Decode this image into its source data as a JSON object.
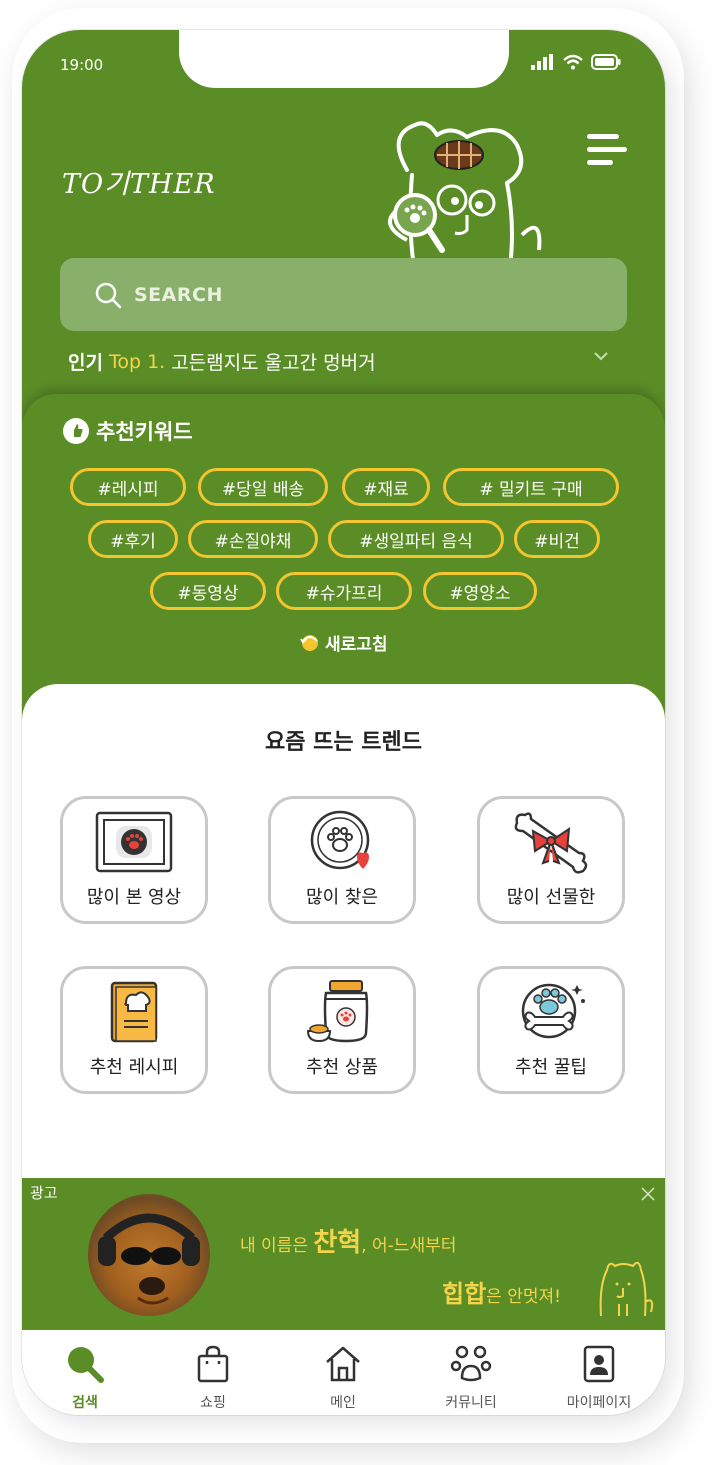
{
  "status": {
    "time": "19:00"
  },
  "header": {
    "logo": "TO기THER",
    "menu_icon": "hamburger-icon"
  },
  "search": {
    "placeholder": "SEARCH"
  },
  "popular": {
    "prefix": "인기",
    "rank": "Top 1.",
    "text": "고든램지도 울고간 멍버거"
  },
  "keywords": {
    "title": "추천키워드",
    "tags": [
      "#레시피",
      "#당일 배송",
      "#재료",
      "# 밀키트 구매",
      "#후기",
      "#손질야채",
      "#생일파티 음식",
      "#비건",
      "#동영상",
      "#슈가프리",
      "#영양소"
    ],
    "refresh": "새로고침"
  },
  "trends": {
    "title": "요즘 뜨는 트렌드",
    "items": [
      {
        "label": "많이 본 영상",
        "icon": "video-paw-icon"
      },
      {
        "label": "많이 찾은",
        "icon": "paw-heart-icon"
      },
      {
        "label": "많이 선물한",
        "icon": "bone-ribbon-icon"
      },
      {
        "label": "추천 레시피",
        "icon": "recipe-book-icon"
      },
      {
        "label": "추천 상품",
        "icon": "food-jar-icon"
      },
      {
        "label": "추천 꿀팁",
        "icon": "paw-bone-tip-icon"
      }
    ]
  },
  "ad": {
    "label": "광고",
    "line1_a": "내 이름은 ",
    "line1_b": "찬혁",
    "line1_c": ", 어-느새부터",
    "line2_a": "힙합",
    "line2_b": "은 안멋져!"
  },
  "tabs": [
    {
      "label": "검색",
      "icon": "search-icon",
      "active": true
    },
    {
      "label": "쇼핑",
      "icon": "shopping-bag-icon",
      "active": false
    },
    {
      "label": "메인",
      "icon": "home-icon",
      "active": false
    },
    {
      "label": "커뮤니티",
      "icon": "community-icon",
      "active": false
    },
    {
      "label": "마이페이지",
      "icon": "profile-icon",
      "active": false
    }
  ],
  "colors": {
    "brand_green": "#5b8d27",
    "accent_yellow": "#f3c52e"
  }
}
